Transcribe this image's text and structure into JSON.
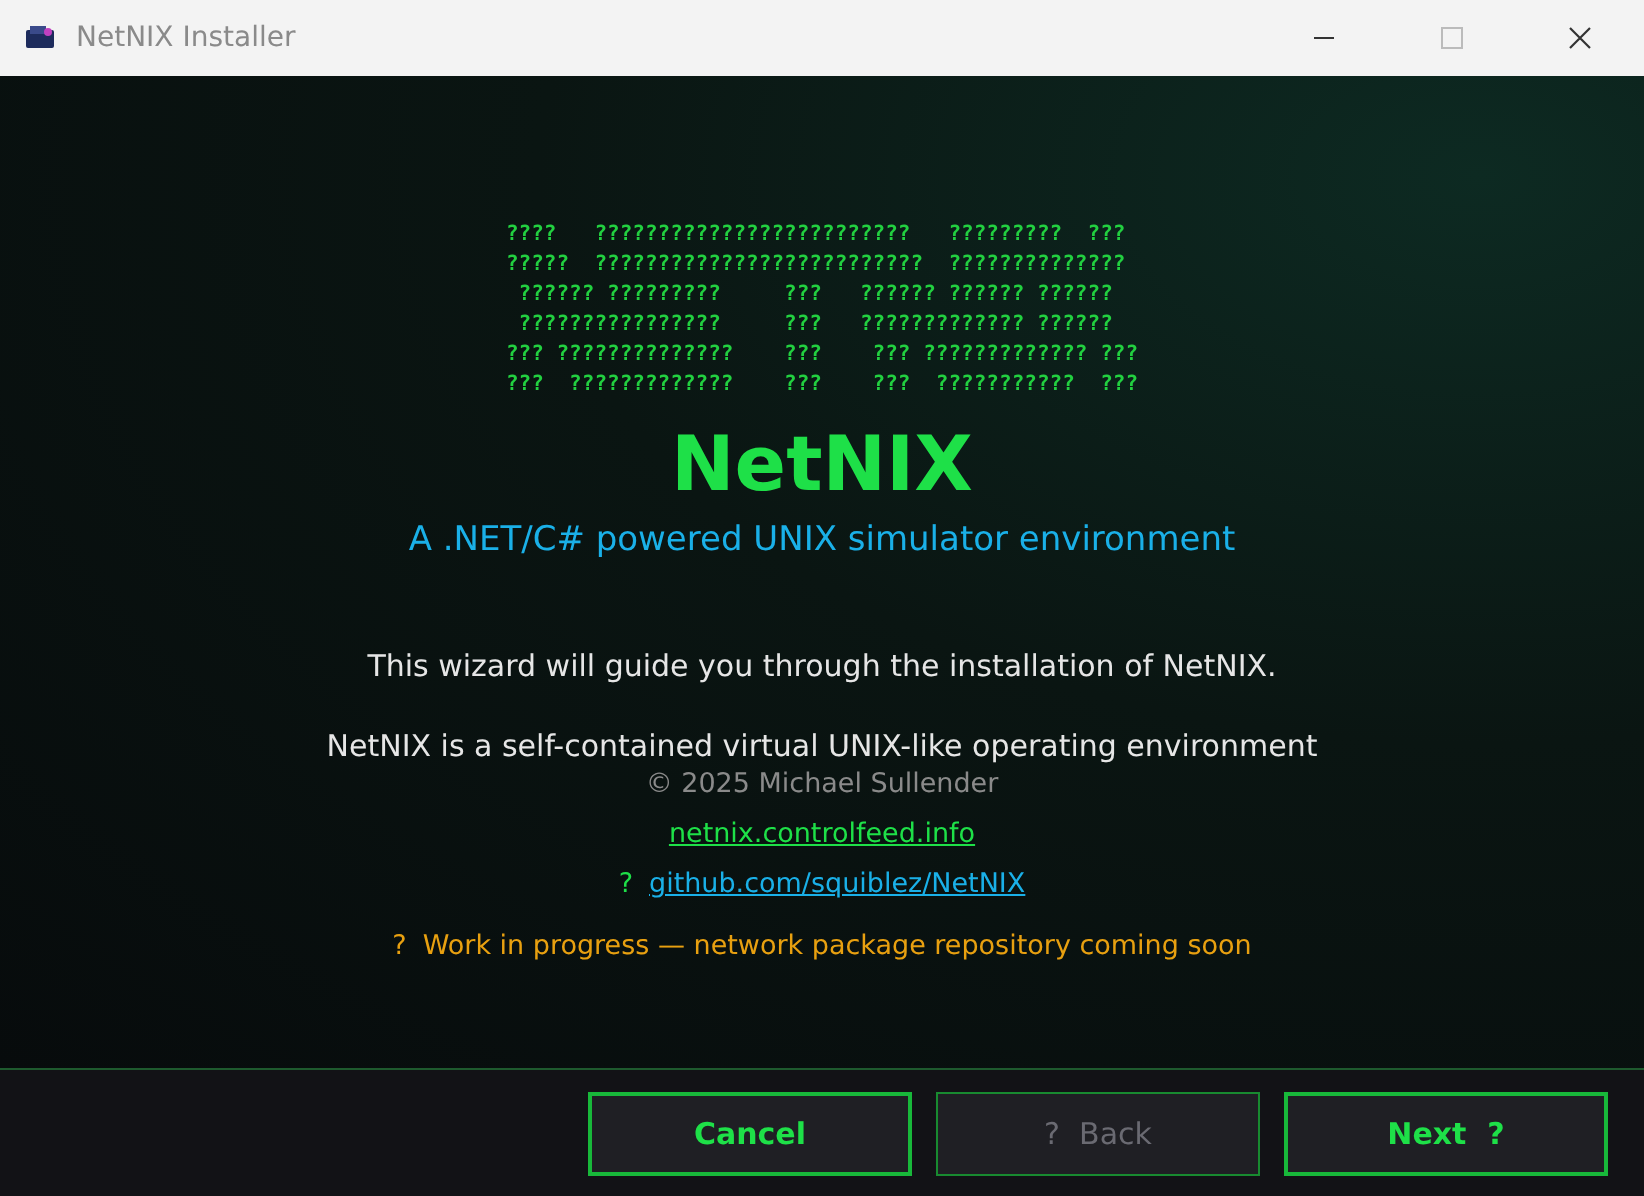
{
  "window": {
    "title": "NetNIX Installer"
  },
  "banner": {
    "art_lines": [
      "????   ?????????????????????????   ?????????  ???",
      "?????  ??????????????????????????  ??????????????",
      " ?????? ?????????     ???   ?????? ?????? ??????",
      " ????????????????     ???   ????????????? ??????",
      "??? ??????????????    ???    ??? ????????????? ???",
      "???  ?????????????    ???    ???  ???????????  ???"
    ],
    "title": "NetNIX",
    "subtitle": "A .NET/C# powered UNIX simulator environment"
  },
  "intro": "This wizard will guide you through the installation of NetNIX.",
  "description": "NetNIX is a self-contained virtual UNIX-like operating environment",
  "copyright": "© 2025 Michael Sullender",
  "links": [
    {
      "kind": "site",
      "label": "netnix.controlfeed.info"
    },
    {
      "kind": "repo",
      "prefix": "?",
      "label": "github.com/squiblez/NetNIX"
    }
  ],
  "notice": {
    "prefix": "?",
    "text": "Work in progress — network package repository coming soon"
  },
  "buttons": [
    {
      "label": "Cancel",
      "disabled": false
    },
    {
      "label": "?  Back",
      "disabled": true
    },
    {
      "label": "Next  ?",
      "disabled": false
    }
  ]
}
